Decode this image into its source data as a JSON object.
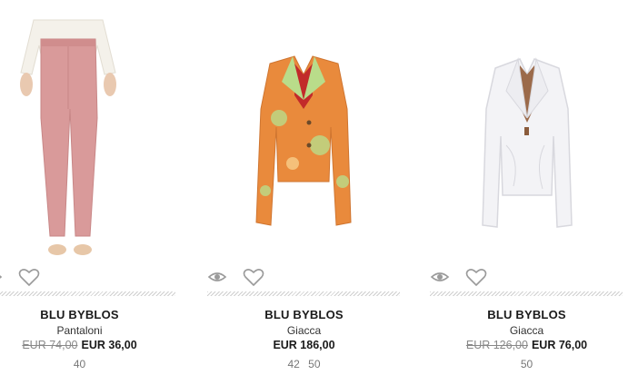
{
  "products": [
    {
      "brand": "BLU BYBLOS",
      "category": "Pantaloni",
      "old_price": "EUR 74,00",
      "price": "EUR 36,00",
      "sizes": "40",
      "image": "pink-trousers-image",
      "colors": {
        "primary": "#d99a9a",
        "top": "#f4f1ea",
        "skin": "#e9c9b0",
        "shoe": "#e7c7a8"
      }
    },
    {
      "brand": "BLU BYBLOS",
      "category": "Giacca",
      "old_price": "",
      "price": "EUR 186,00",
      "sizes": "42 50",
      "image": "floral-jacket-image",
      "colors": {
        "primary": "#e98a3c",
        "secondary": "#b9dc8a",
        "lining": "#c22a2a"
      }
    },
    {
      "brand": "BLU BYBLOS",
      "category": "Giacca",
      "old_price": "EUR 126,00",
      "price": "EUR 76,00",
      "sizes": "50",
      "image": "white-jacket-image",
      "colors": {
        "primary": "#f3f3f6",
        "shadow": "#d8d8de",
        "lining": "#9b6a4a"
      }
    }
  ],
  "icons": {
    "quick_view": "eye-icon",
    "wishlist": "heart-icon"
  }
}
